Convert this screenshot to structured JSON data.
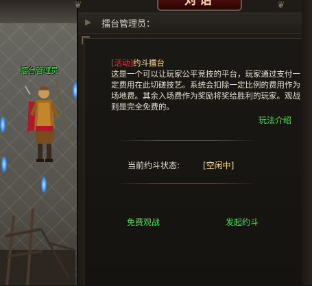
{
  "scene": {
    "npc_name": "擂台管理员"
  },
  "dialog": {
    "window_title": "对话",
    "header_title": "擂台管理员：",
    "intro": {
      "tag": "[活动]",
      "title": "约斗擂台",
      "body": "这是一个可以让玩家公平竞技的平台，玩家通过支付一定费用在此切磋技艺。系统会扣除一定比例的费用作为场地费。其余入场费作为奖励将奖给胜利的玩家。观战则是完全免费的。"
    },
    "help_link": "玩法介绍",
    "status": {
      "label": "当前约斗状态:",
      "value": "[空闲中]"
    },
    "actions": {
      "watch": "免费观战",
      "challenge": "发起约斗"
    }
  },
  "colors": {
    "link_green": "#48e34a",
    "tag_red": "#e64040",
    "title_yellow": "#ffe08a"
  }
}
